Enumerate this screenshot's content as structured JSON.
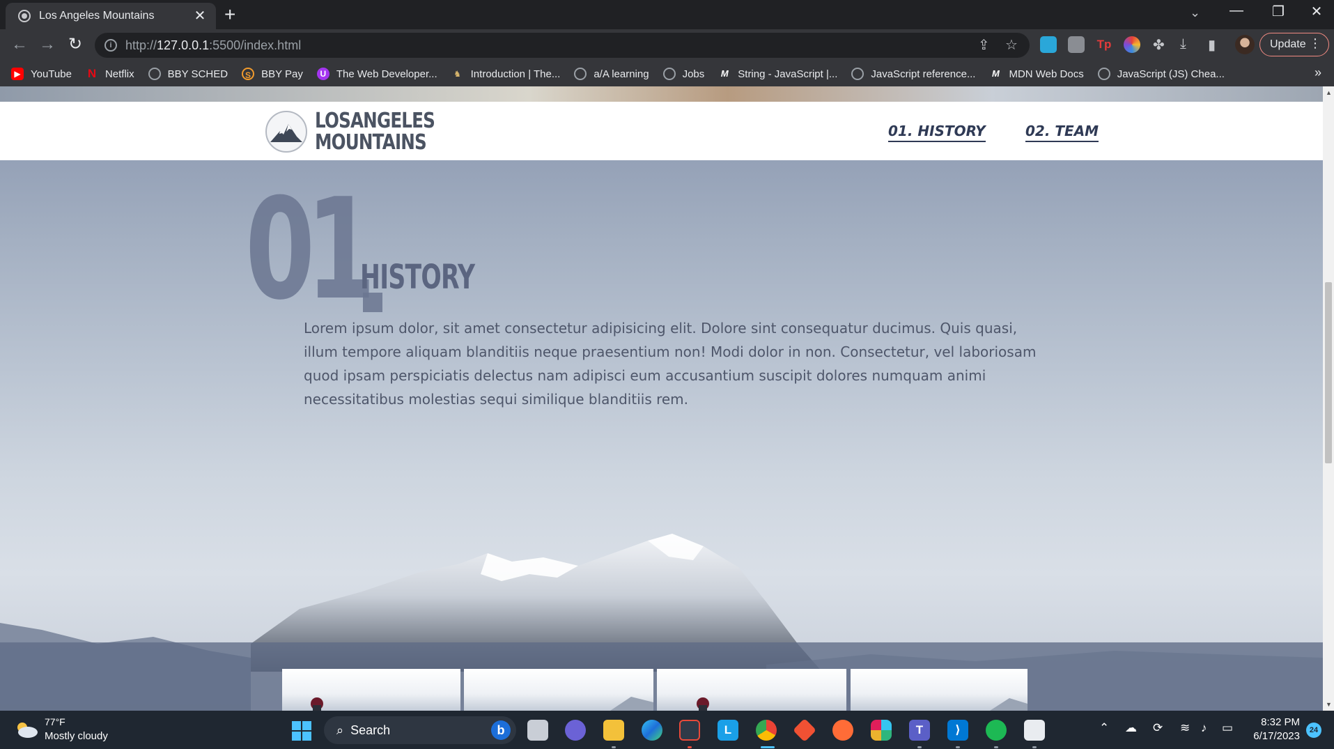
{
  "browser": {
    "tab": {
      "title": "Los Angeles Mountains",
      "close": "✕"
    },
    "new_tab": "+",
    "url": {
      "prefix": "http://",
      "host": "127.0.0.1",
      "path": ":5500/index.html"
    },
    "update_label": "Update",
    "bookmarks": [
      {
        "label": "YouTube",
        "icon": "youtube-icon",
        "color": "#ff0000"
      },
      {
        "label": "Netflix",
        "icon": "netflix-icon",
        "color": "#e50914"
      },
      {
        "label": "BBY SCHED",
        "icon": "globe-icon",
        "color": "#9aa0a6"
      },
      {
        "label": "BBY Pay",
        "icon": "bby-pay-icon",
        "color": "#f29b2c"
      },
      {
        "label": "The Web Developer...",
        "icon": "udemy-icon",
        "color": "#a435f0"
      },
      {
        "label": "Introduction | The...",
        "icon": "odin-icon",
        "color": "#d9b76d"
      },
      {
        "label": "a/A learning",
        "icon": "globe-icon",
        "color": "#9aa0a6"
      },
      {
        "label": "Jobs",
        "icon": "globe-icon",
        "color": "#9aa0a6"
      },
      {
        "label": "String - JavaScript |...",
        "icon": "mdn-icon",
        "color": "#ffffff"
      },
      {
        "label": "JavaScript reference...",
        "icon": "globe-icon",
        "color": "#9aa0a6"
      },
      {
        "label": "MDN Web Docs",
        "icon": "mdn-icon",
        "color": "#ffffff"
      },
      {
        "label": "JavaScript (JS) Chea...",
        "icon": "globe-icon",
        "color": "#9aa0a6"
      }
    ],
    "bookmarks_overflow": "»"
  },
  "site": {
    "logo": {
      "line1": "LOSANGELES",
      "line2": "MOUNTAINS"
    },
    "nav": [
      {
        "label": "01. HISTORY"
      },
      {
        "label": "02. TEAM"
      }
    ],
    "section": {
      "number": "01",
      "title": "HISTORY",
      "body": "Lorem ipsum dolor, sit amet consectetur adipisicing elit. Dolore sint consequatur ducimus. Quis quasi, illum tempore aliquam blanditiis neque praesentium non! Modi dolor in non. Consectetur, vel laboriosam quod ipsam perspiciatis delectus nam adipisci eum accusantium suscipit dolores numquam animi necessitatibus molestias sequi similique blanditiis rem."
    },
    "colors": {
      "accent": "#2f3a55",
      "heading": "#5b6580",
      "text": "#4e566a"
    }
  },
  "taskbar": {
    "weather": {
      "temp": "77°F",
      "desc": "Mostly cloudy"
    },
    "search_label": "Search",
    "clock": {
      "time": "8:32 PM",
      "date": "6/17/2023"
    },
    "notifications": "24"
  }
}
